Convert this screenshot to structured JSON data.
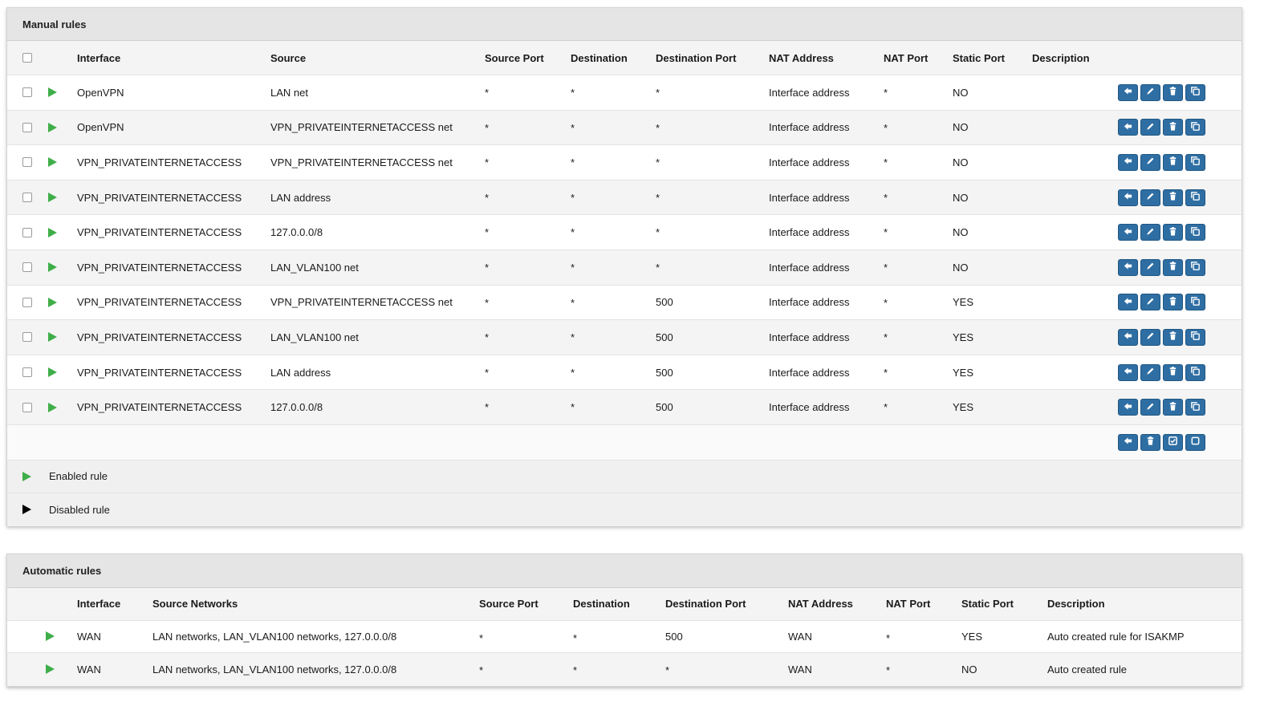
{
  "manual": {
    "title": "Manual rules",
    "headers": {
      "interface": "Interface",
      "source": "Source",
      "source_port": "Source Port",
      "destination": "Destination",
      "destination_port": "Destination Port",
      "nat_address": "NAT Address",
      "nat_port": "NAT Port",
      "static_port": "Static Port",
      "description": "Description"
    },
    "rows": [
      {
        "interface": "OpenVPN",
        "source": "LAN net",
        "source_port": "*",
        "destination": "*",
        "destination_port": "*",
        "nat_address": "Interface address",
        "nat_port": "*",
        "static_port": "NO",
        "description": ""
      },
      {
        "interface": "OpenVPN",
        "source": "VPN_PRIVATEINTERNETACCESS net",
        "source_port": "*",
        "destination": "*",
        "destination_port": "*",
        "nat_address": "Interface address",
        "nat_port": "*",
        "static_port": "NO",
        "description": ""
      },
      {
        "interface": "VPN_PRIVATEINTERNETACCESS",
        "source": "VPN_PRIVATEINTERNETACCESS net",
        "source_port": "*",
        "destination": "*",
        "destination_port": "*",
        "nat_address": "Interface address",
        "nat_port": "*",
        "static_port": "NO",
        "description": ""
      },
      {
        "interface": "VPN_PRIVATEINTERNETACCESS",
        "source": "LAN address",
        "source_port": "*",
        "destination": "*",
        "destination_port": "*",
        "nat_address": "Interface address",
        "nat_port": "*",
        "static_port": "NO",
        "description": ""
      },
      {
        "interface": "VPN_PRIVATEINTERNETACCESS",
        "source": "127.0.0.0/8",
        "source_port": "*",
        "destination": "*",
        "destination_port": "*",
        "nat_address": "Interface address",
        "nat_port": "*",
        "static_port": "NO",
        "description": ""
      },
      {
        "interface": "VPN_PRIVATEINTERNETACCESS",
        "source": "LAN_VLAN100 net",
        "source_port": "*",
        "destination": "*",
        "destination_port": "*",
        "nat_address": "Interface address",
        "nat_port": "*",
        "static_port": "NO",
        "description": ""
      },
      {
        "interface": "VPN_PRIVATEINTERNETACCESS",
        "source": "VPN_PRIVATEINTERNETACCESS net",
        "source_port": "*",
        "destination": "*",
        "destination_port": "500",
        "nat_address": "Interface address",
        "nat_port": "*",
        "static_port": "YES",
        "description": ""
      },
      {
        "interface": "VPN_PRIVATEINTERNETACCESS",
        "source": "LAN_VLAN100 net",
        "source_port": "*",
        "destination": "*",
        "destination_port": "500",
        "nat_address": "Interface address",
        "nat_port": "*",
        "static_port": "YES",
        "description": ""
      },
      {
        "interface": "VPN_PRIVATEINTERNETACCESS",
        "source": "LAN address",
        "source_port": "*",
        "destination": "*",
        "destination_port": "500",
        "nat_address": "Interface address",
        "nat_port": "*",
        "static_port": "YES",
        "description": ""
      },
      {
        "interface": "VPN_PRIVATEINTERNETACCESS",
        "source": "127.0.0.0/8",
        "source_port": "*",
        "destination": "*",
        "destination_port": "500",
        "nat_address": "Interface address",
        "nat_port": "*",
        "static_port": "YES",
        "description": ""
      }
    ],
    "row_actions": [
      "arrow-left-icon",
      "pencil-icon",
      "trash-icon",
      "clone-icon"
    ],
    "bulk_actions": [
      "arrow-left-icon",
      "trash-icon",
      "check-square-icon",
      "square-icon"
    ],
    "legend": {
      "enabled": "Enabled rule",
      "disabled": "Disabled rule"
    }
  },
  "automatic": {
    "title": "Automatic rules",
    "headers": {
      "interface": "Interface",
      "source_networks": "Source Networks",
      "source_port": "Source Port",
      "destination": "Destination",
      "destination_port": "Destination Port",
      "nat_address": "NAT Address",
      "nat_port": "NAT Port",
      "static_port": "Static Port",
      "description": "Description"
    },
    "rows": [
      {
        "interface": "WAN",
        "source_networks": "LAN networks, LAN_VLAN100 networks, 127.0.0.0/8",
        "source_port": "*",
        "destination": "*",
        "destination_port": "500",
        "nat_address": "WAN",
        "nat_port": "*",
        "static_port": "YES",
        "description": "Auto created rule for ISAKMP"
      },
      {
        "interface": "WAN",
        "source_networks": "LAN networks, LAN_VLAN100 networks, 127.0.0.0/8",
        "source_port": "*",
        "destination": "*",
        "destination_port": "*",
        "nat_address": "WAN",
        "nat_port": "*",
        "static_port": "NO",
        "description": "Auto created rule"
      }
    ]
  },
  "colors": {
    "button_blue": "#2e6ea3",
    "enabled_green": "#3fae49",
    "header_gray": "#e5e5e5"
  }
}
